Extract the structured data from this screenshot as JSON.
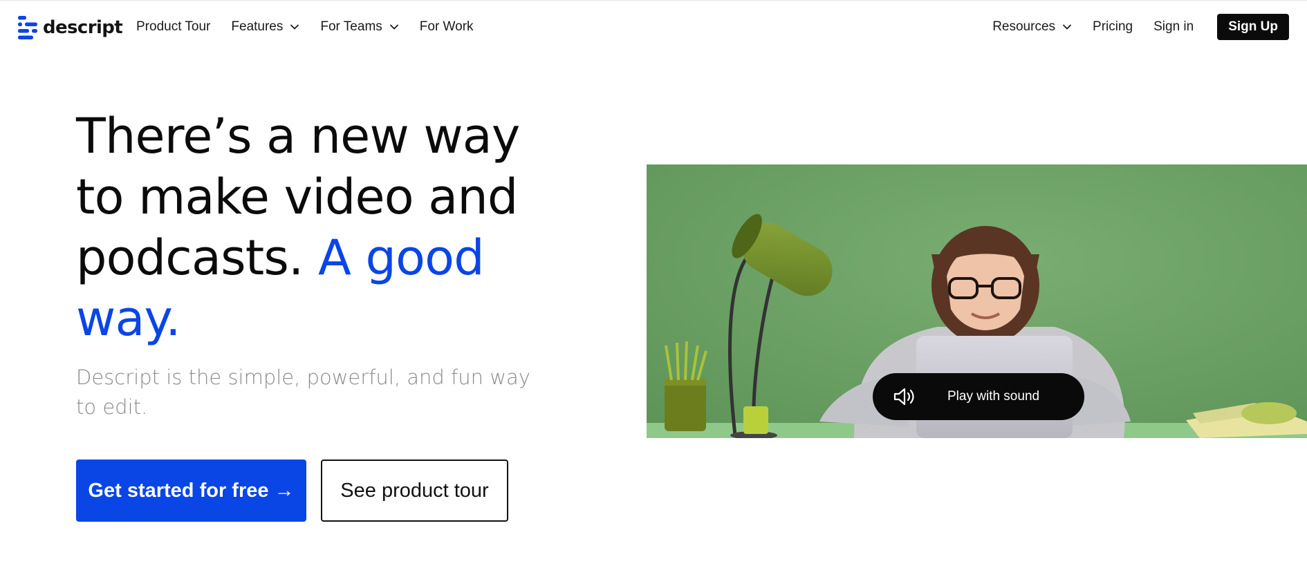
{
  "brand": {
    "name": "descript",
    "accent_color": "#0a45e6"
  },
  "nav": {
    "left": [
      {
        "label": "Product Tour",
        "dropdown": false
      },
      {
        "label": "Features",
        "dropdown": true
      },
      {
        "label": "For Teams",
        "dropdown": true
      },
      {
        "label": "For Work",
        "dropdown": false
      }
    ],
    "right": [
      {
        "label": "Resources",
        "dropdown": true
      },
      {
        "label": "Pricing",
        "dropdown": false
      },
      {
        "label": "Sign in",
        "dropdown": false
      }
    ],
    "signup_label": "Sign Up"
  },
  "hero": {
    "headline_lines": [
      "There’s a new way",
      "to make video and",
      "podcasts. "
    ],
    "headline_accent_inline": "A good",
    "headline_accent_last": "way.",
    "subheadline": "Descript is the simple, powerful, and fun way to edit.",
    "cta_primary": "Get started for free →",
    "cta_secondary": "See product tour"
  },
  "video": {
    "play_with_sound_label": "Play with sound",
    "play_icon": "speaker-icon"
  },
  "colors": {
    "primary_button": "#0a45e6",
    "signup_button": "#0b0b0b",
    "video_background": "#6ea068"
  }
}
